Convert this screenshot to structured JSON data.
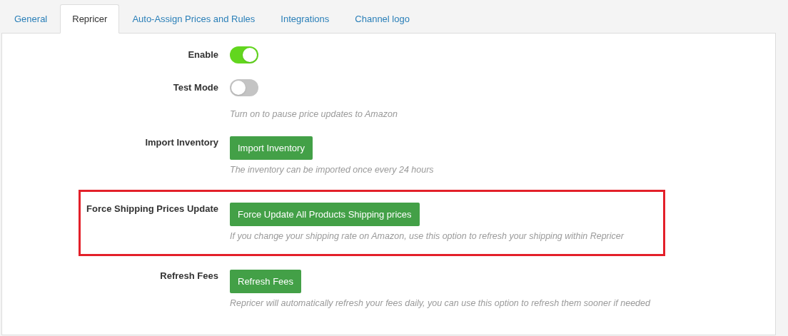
{
  "tabs": [
    {
      "label": "General",
      "selected": false
    },
    {
      "label": "Repricer",
      "selected": true
    },
    {
      "label": "Auto-Assign Prices and Rules",
      "selected": false
    },
    {
      "label": "Integrations",
      "selected": false
    },
    {
      "label": "Channel logo",
      "selected": false
    }
  ],
  "settings": [
    {
      "kind": "toggle",
      "label": "Enable",
      "on": true,
      "highlighted": false
    },
    {
      "kind": "toggle",
      "label": "Test Mode",
      "on": false,
      "hint": "Turn on to pause price updates to Amazon",
      "highlighted": false
    },
    {
      "kind": "button",
      "label": "Import Inventory",
      "button": "Import Inventory",
      "hint": "The inventory can be imported once every 24 hours",
      "highlighted": false
    },
    {
      "kind": "button",
      "label": "Force Shipping Prices Update",
      "button": "Force Update All Products Shipping prices",
      "hint": "If you change your shipping rate on Amazon, use this option to refresh your shipping within Repricer",
      "highlighted": true
    },
    {
      "kind": "button",
      "label": "Refresh Fees",
      "button": "Refresh Fees",
      "hint": "Repricer will automatically refresh your fees daily, you can use this option to refresh them sooner if needed",
      "highlighted": false
    }
  ]
}
